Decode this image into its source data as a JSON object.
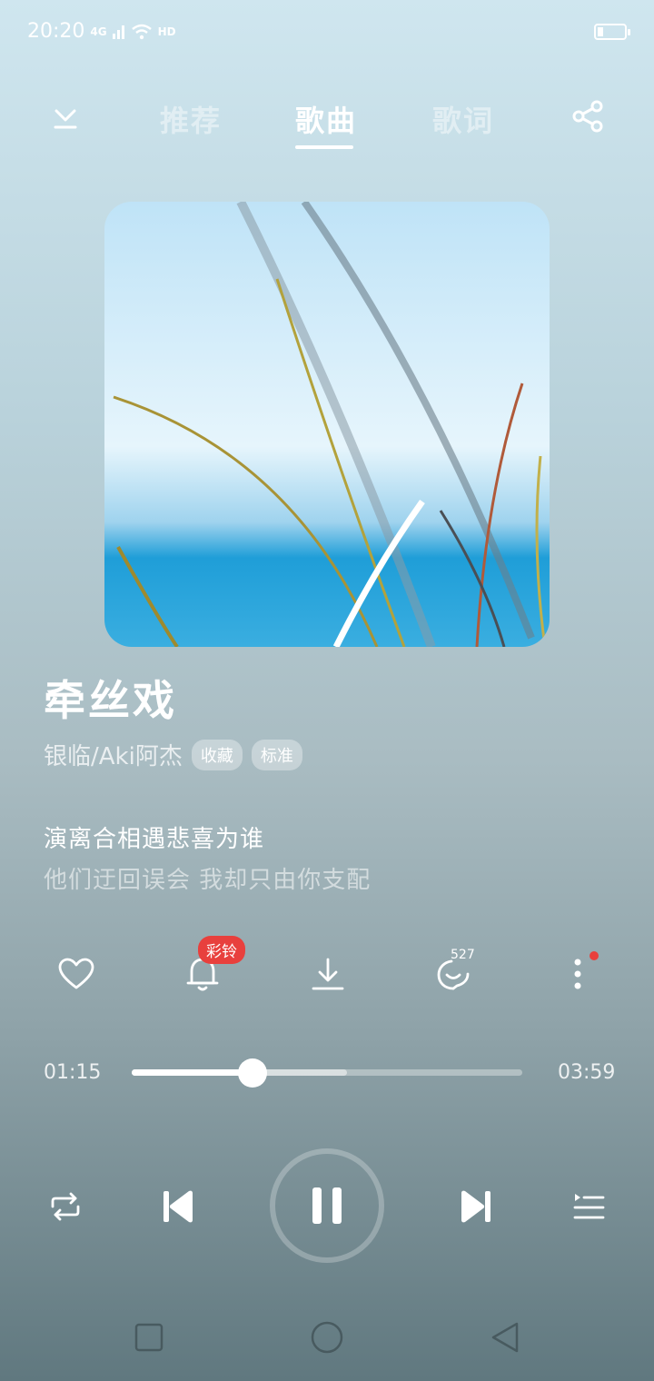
{
  "status_bar": {
    "time": "20:20",
    "network": "4G",
    "hd": "HD"
  },
  "header": {
    "tabs": [
      {
        "label": "推荐"
      },
      {
        "label": "歌曲"
      },
      {
        "label": "歌词"
      }
    ],
    "active_tab": "歌曲"
  },
  "song": {
    "title": "牵丝戏",
    "artist": "银临/Aki阿杰",
    "badges": [
      "收藏",
      "标准"
    ]
  },
  "lyrics": {
    "current": "演离合相遇悲喜为谁",
    "next": "他们迂回误会 我却只由你支配"
  },
  "actions": {
    "ringtone_badge": "彩铃",
    "comment_count": "527"
  },
  "progress": {
    "current_time": "01:15",
    "total_time": "03:59",
    "played_fraction": 0.31,
    "buffered_fraction": 0.55
  },
  "colors": {
    "accent_red": "#e8403d",
    "text": "#ffffff"
  },
  "icons": [
    "collapse-down-icon",
    "share-icon",
    "heart-icon",
    "bell-icon",
    "download-icon",
    "comment-icon",
    "more-vertical-icon",
    "repeat-icon",
    "previous-icon",
    "pause-icon",
    "next-icon",
    "playlist-icon",
    "nav-recent-icon",
    "nav-home-icon",
    "nav-back-icon"
  ]
}
